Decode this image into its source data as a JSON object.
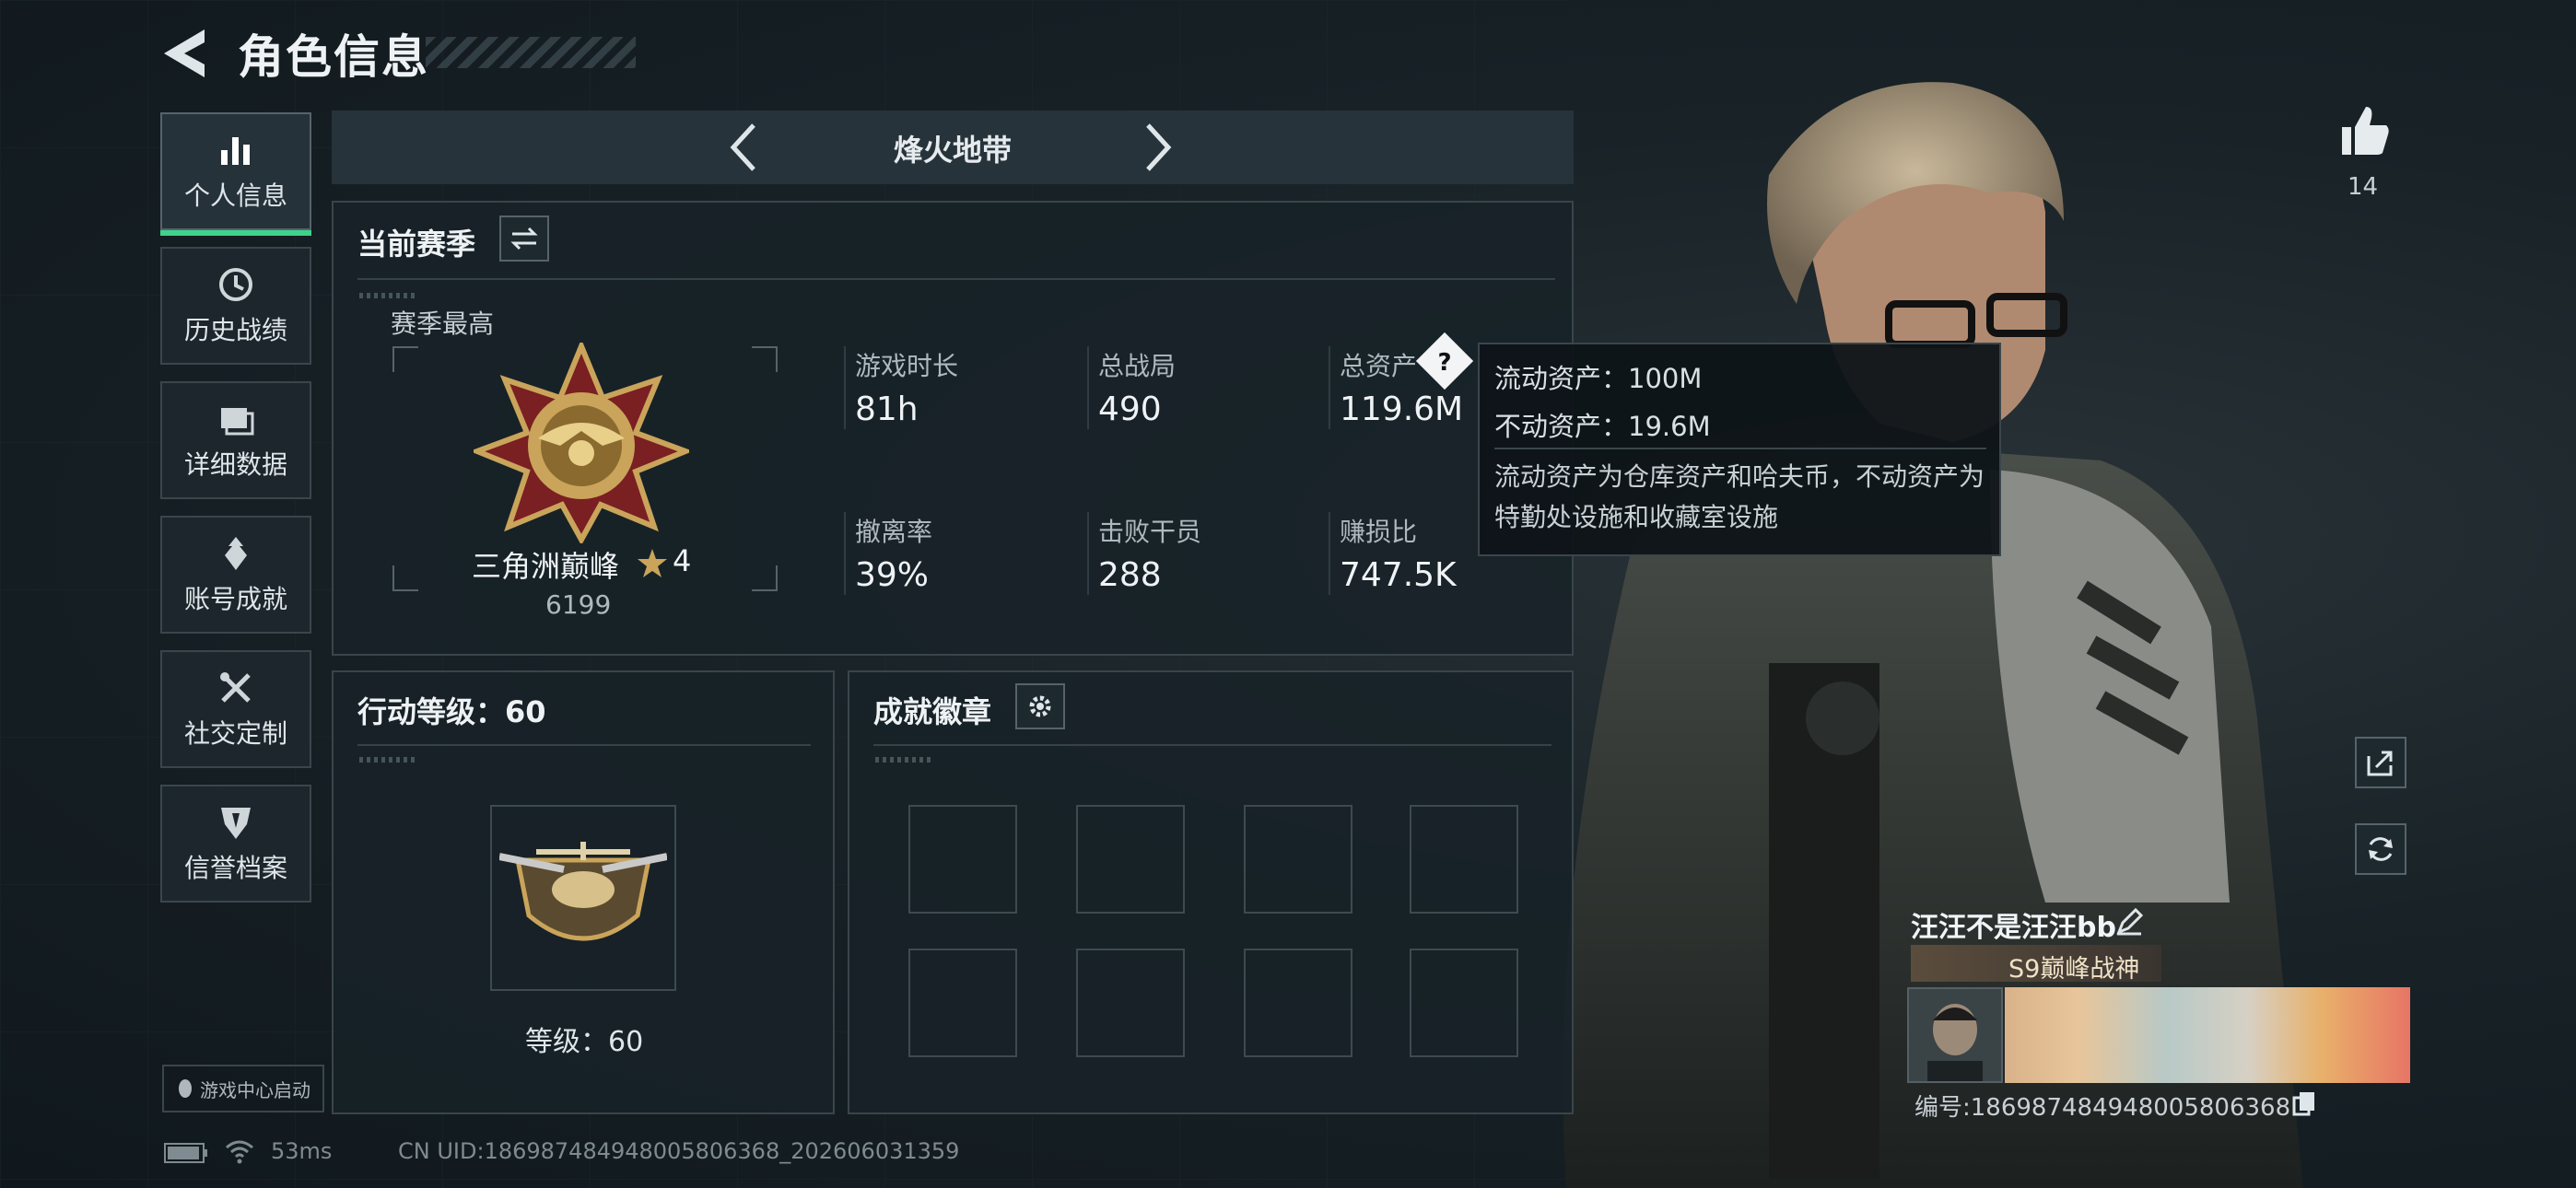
{
  "header": {
    "title": "角色信息"
  },
  "sidebar": {
    "items": [
      {
        "label": "个人信息",
        "icon": "bar-chart-icon"
      },
      {
        "label": "历史战绩",
        "icon": "history-icon"
      },
      {
        "label": "详细数据",
        "icon": "folder-icon"
      },
      {
        "label": "账号成就",
        "icon": "medal-icon"
      },
      {
        "label": "社交定制",
        "icon": "tools-icon"
      },
      {
        "label": "信誉档案",
        "icon": "badge-shield-icon"
      }
    ],
    "launch_label": "游戏中心启动"
  },
  "mode_bar": {
    "mode": "烽火地带"
  },
  "season": {
    "title": "当前赛季",
    "best_label": "赛季最高",
    "rank_name": "三角洲巅峰",
    "stars": "4",
    "score": "6199",
    "stats": [
      {
        "label": "游戏时长",
        "value": "81h"
      },
      {
        "label": "总战局",
        "value": "490"
      },
      {
        "label": "总资产",
        "value": "119.6M"
      },
      {
        "label": "撤离率",
        "value": "39%"
      },
      {
        "label": "击败干员",
        "value": "288"
      },
      {
        "label": "赚损比",
        "value": "747.5K"
      }
    ]
  },
  "tooltip": {
    "liquid": "流动资产：100M",
    "fixed": "不动资产：19.6M",
    "desc": "流动资产为仓库资产和哈夫币，不动资产为特勤处设施和收藏室设施"
  },
  "action_level": {
    "title": "行动等级：60",
    "level_text": "等级：60"
  },
  "badges": {
    "title": "成就徽章"
  },
  "player": {
    "name": "汪汪不是汪汪bb",
    "title": "S9巅峰战神",
    "id_text": "编号:1869874849480058063​68",
    "likes": "14"
  },
  "status": {
    "ping": "53ms",
    "uid": "CN UID:1869874849480058063​68_202606031359"
  },
  "colors": {
    "accent": "#3fd28c",
    "panel": "#182228",
    "gold": "#c9a45a"
  }
}
